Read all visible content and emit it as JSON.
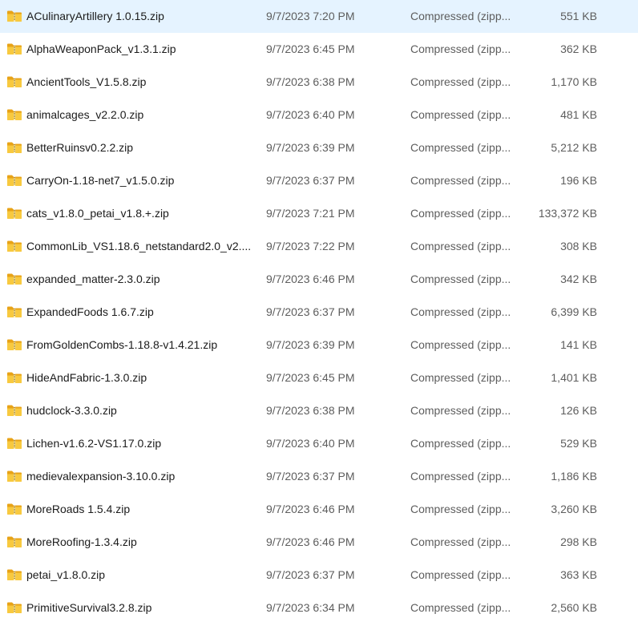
{
  "file_list": {
    "icon": "zip-folder-icon",
    "colors": {
      "folder_body": "#e8a317",
      "folder_front": "#f8c93f",
      "zipper": "#8a6a10",
      "secondary_text": "#5d5d5d"
    },
    "rows": [
      {
        "name": "ACulinaryArtillery 1.0.15.zip",
        "date": "9/7/2023 7:20 PM",
        "type": "Compressed (zipp...",
        "size": "551 KB"
      },
      {
        "name": "AlphaWeaponPack_v1.3.1.zip",
        "date": "9/7/2023 6:45 PM",
        "type": "Compressed (zipp...",
        "size": "362 KB"
      },
      {
        "name": "AncientTools_V1.5.8.zip",
        "date": "9/7/2023 6:38 PM",
        "type": "Compressed (zipp...",
        "size": "1,170 KB"
      },
      {
        "name": "animalcages_v2.2.0.zip",
        "date": "9/7/2023 6:40 PM",
        "type": "Compressed (zipp...",
        "size": "481 KB"
      },
      {
        "name": "BetterRuinsv0.2.2.zip",
        "date": "9/7/2023 6:39 PM",
        "type": "Compressed (zipp...",
        "size": "5,212 KB"
      },
      {
        "name": "CarryOn-1.18-net7_v1.5.0.zip",
        "date": "9/7/2023 6:37 PM",
        "type": "Compressed (zipp...",
        "size": "196 KB"
      },
      {
        "name": "cats_v1.8.0_petai_v1.8.+.zip",
        "date": "9/7/2023 7:21 PM",
        "type": "Compressed (zipp...",
        "size": "133,372 KB"
      },
      {
        "name": "CommonLib_VS1.18.6_netstandard2.0_v2....",
        "date": "9/7/2023 7:22 PM",
        "type": "Compressed (zipp...",
        "size": "308 KB"
      },
      {
        "name": "expanded_matter-2.3.0.zip",
        "date": "9/7/2023 6:46 PM",
        "type": "Compressed (zipp...",
        "size": "342 KB"
      },
      {
        "name": "ExpandedFoods 1.6.7.zip",
        "date": "9/7/2023 6:37 PM",
        "type": "Compressed (zipp...",
        "size": "6,399 KB"
      },
      {
        "name": "FromGoldenCombs-1.18.8-v1.4.21.zip",
        "date": "9/7/2023 6:39 PM",
        "type": "Compressed (zipp...",
        "size": "141 KB"
      },
      {
        "name": "HideAndFabric-1.3.0.zip",
        "date": "9/7/2023 6:45 PM",
        "type": "Compressed (zipp...",
        "size": "1,401 KB"
      },
      {
        "name": "hudclock-3.3.0.zip",
        "date": "9/7/2023 6:38 PM",
        "type": "Compressed (zipp...",
        "size": "126 KB"
      },
      {
        "name": "Lichen-v1.6.2-VS1.17.0.zip",
        "date": "9/7/2023 6:40 PM",
        "type": "Compressed (zipp...",
        "size": "529 KB"
      },
      {
        "name": "medievalexpansion-3.10.0.zip",
        "date": "9/7/2023 6:37 PM",
        "type": "Compressed (zipp...",
        "size": "1,186 KB"
      },
      {
        "name": "MoreRoads 1.5.4.zip",
        "date": "9/7/2023 6:46 PM",
        "type": "Compressed (zipp...",
        "size": "3,260 KB"
      },
      {
        "name": "MoreRoofing-1.3.4.zip",
        "date": "9/7/2023 6:46 PM",
        "type": "Compressed (zipp...",
        "size": "298 KB"
      },
      {
        "name": "petai_v1.8.0.zip",
        "date": "9/7/2023 6:37 PM",
        "type": "Compressed (zipp...",
        "size": "363 KB"
      },
      {
        "name": "PrimitiveSurvival3.2.8.zip",
        "date": "9/7/2023 6:34 PM",
        "type": "Compressed (zipp...",
        "size": "2,560 KB"
      }
    ]
  }
}
